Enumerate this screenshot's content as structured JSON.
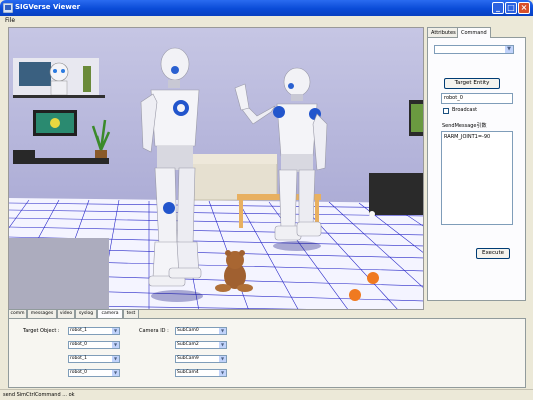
{
  "window": {
    "title": "SIGVerse Viewer"
  },
  "menu": {
    "file": "File"
  },
  "right_panel": {
    "tabs": [
      {
        "label": "Attributes",
        "active": false
      },
      {
        "label": "Command",
        "active": true
      }
    ],
    "dropdown_value": "",
    "target_entity_button": "Target Entity",
    "entity_value": "robot_0",
    "broadcast_label": "Broadcast",
    "broadcast_checked": false,
    "send_message_label": "SendMessage引数",
    "message_text": "RARM_JOINT1=-90",
    "execute_button": "Execute"
  },
  "bottom_tabs": [
    {
      "label": "comm",
      "active": false
    },
    {
      "label": "messages",
      "active": false
    },
    {
      "label": "video",
      "active": false
    },
    {
      "label": "syslog",
      "active": false
    },
    {
      "label": "camera",
      "active": true
    },
    {
      "label": "test",
      "active": false
    }
  ],
  "camera_panel": {
    "target_object_label": "Target Object :",
    "camera_id_label": "Camera ID :",
    "rows": [
      {
        "target": "robot_1",
        "camera": "SubCam0"
      },
      {
        "target": "robot_0",
        "camera": "SubCam2"
      },
      {
        "target": "robot_1",
        "camera": "SubCam9"
      },
      {
        "target": "robot_0",
        "camera": "SubCam4"
      }
    ]
  },
  "status": {
    "text": "send SimCtrlCommand ... ok"
  },
  "colors": {
    "titlebar": "#0A4BD7",
    "sky": "#B8B8DA",
    "floor_grid": "#2020C0",
    "robot_body": "#F0F0F4",
    "robot_joint": "#2255CC"
  }
}
